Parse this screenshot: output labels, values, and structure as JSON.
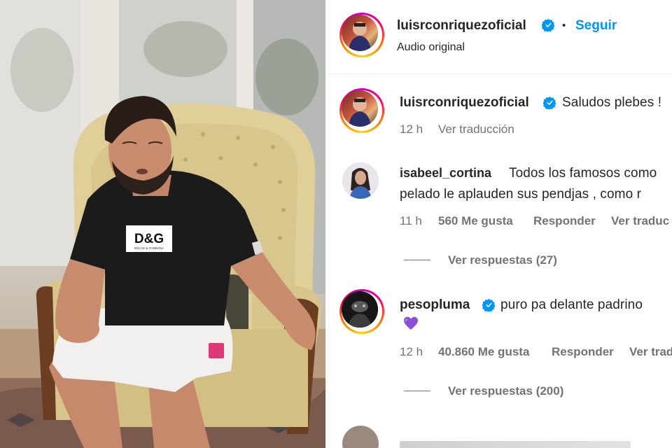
{
  "header": {
    "username": "luisrconriquezoficial",
    "separator": "•",
    "follow_label": "Seguir",
    "audio_label": "Audio original",
    "verified_icon": "verified-badge-icon",
    "accent_color": "#0095f6"
  },
  "comments": [
    {
      "username": "luisrconriquezoficial",
      "verified": true,
      "text": "Saludos plebes !",
      "time": "12 h",
      "translate": "Ver traducción"
    },
    {
      "username": "isabeel_cortina",
      "verified": false,
      "text_line1": "Todos los famosos como",
      "text_line2": "pelado le aplauden sus pendjas , como r",
      "time": "11 h",
      "likes": "560 Me gusta",
      "reply": "Responder",
      "translate": "Ver traduc",
      "view_replies": "Ver respuestas (27)"
    },
    {
      "username": "pesopluma",
      "verified": true,
      "text": "puro pa delante padrino",
      "time": "12 h",
      "likes": "40.860 Me gusta",
      "reply": "Responder",
      "translate": "Ver trad",
      "view_replies": "Ver respuestas (200)",
      "emoji_icon": "purple-heart-emoji-icon"
    }
  ],
  "media": {
    "shirt_logo": "D&G",
    "shirt_sublabel": "DOLCE & GABBANA"
  }
}
